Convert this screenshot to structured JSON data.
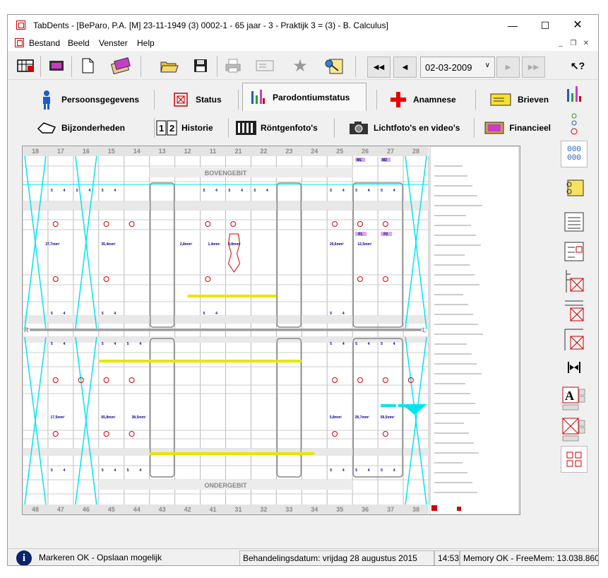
{
  "window": {
    "title": "TabDents - [BeParo, P.A. [M] 23-11-1949 (3) 0002-1 - 65 jaar - 3 - Praktijk 3 = (3) - B. Calculus]"
  },
  "menu": [
    "Bestand",
    "Beeld",
    "Venster",
    "Help"
  ],
  "toolbar": {
    "date": "02-03-2009"
  },
  "tabs": {
    "row1": [
      "Persoonsgegevens",
      "Status",
      "Parodontiumstatus",
      "Anamnese",
      "Brieven"
    ],
    "row2": [
      "Bijzonderheden",
      "Historie",
      "Röntgenfoto's",
      "Lichtfoto's en video's",
      "Financieel"
    ],
    "active": "Parodontiumstatus"
  },
  "chart": {
    "upper_teeth": [
      "18",
      "17",
      "16",
      "15",
      "14",
      "13",
      "12",
      "11",
      "21",
      "22",
      "23",
      "24",
      "25",
      "26",
      "27",
      "28"
    ],
    "lower_teeth": [
      "48",
      "47",
      "46",
      "45",
      "44",
      "43",
      "42",
      "41",
      "31",
      "32",
      "33",
      "34",
      "35",
      "36",
      "37",
      "38"
    ],
    "upper_label": "BOVENGEBIT",
    "lower_label": "ONDERGEBIT",
    "left_marker": "R",
    "right_marker": "L",
    "furcation_upper": [
      "M1",
      "M2"
    ],
    "furcation_lower": [
      "P1",
      "P2"
    ],
    "upper_areas": [
      "27,7mm²",
      "35,4mm²",
      "2,8mm²",
      "1,4mm²",
      "9,8mm²",
      "29,6mm²",
      "12,5mm²"
    ],
    "lower_areas": [
      "17,5mm²",
      "65,8mm²",
      "38,5mm²",
      "5,8mm²",
      "26,7mm²",
      "59,5mm²"
    ]
  },
  "status": {
    "message": "Markeren OK - Opslaan mogelijk",
    "treatment_date": "Behandelingsdatum: vrijdag 28 augustus 2015",
    "time": "14:53",
    "memory": "Memory OK - FreeMem: 13.038.860 Kb"
  },
  "colors": {
    "cyan": "#00e5ee",
    "yellow": "#e6e600",
    "red": "#d40000",
    "navy": "#00008b"
  }
}
